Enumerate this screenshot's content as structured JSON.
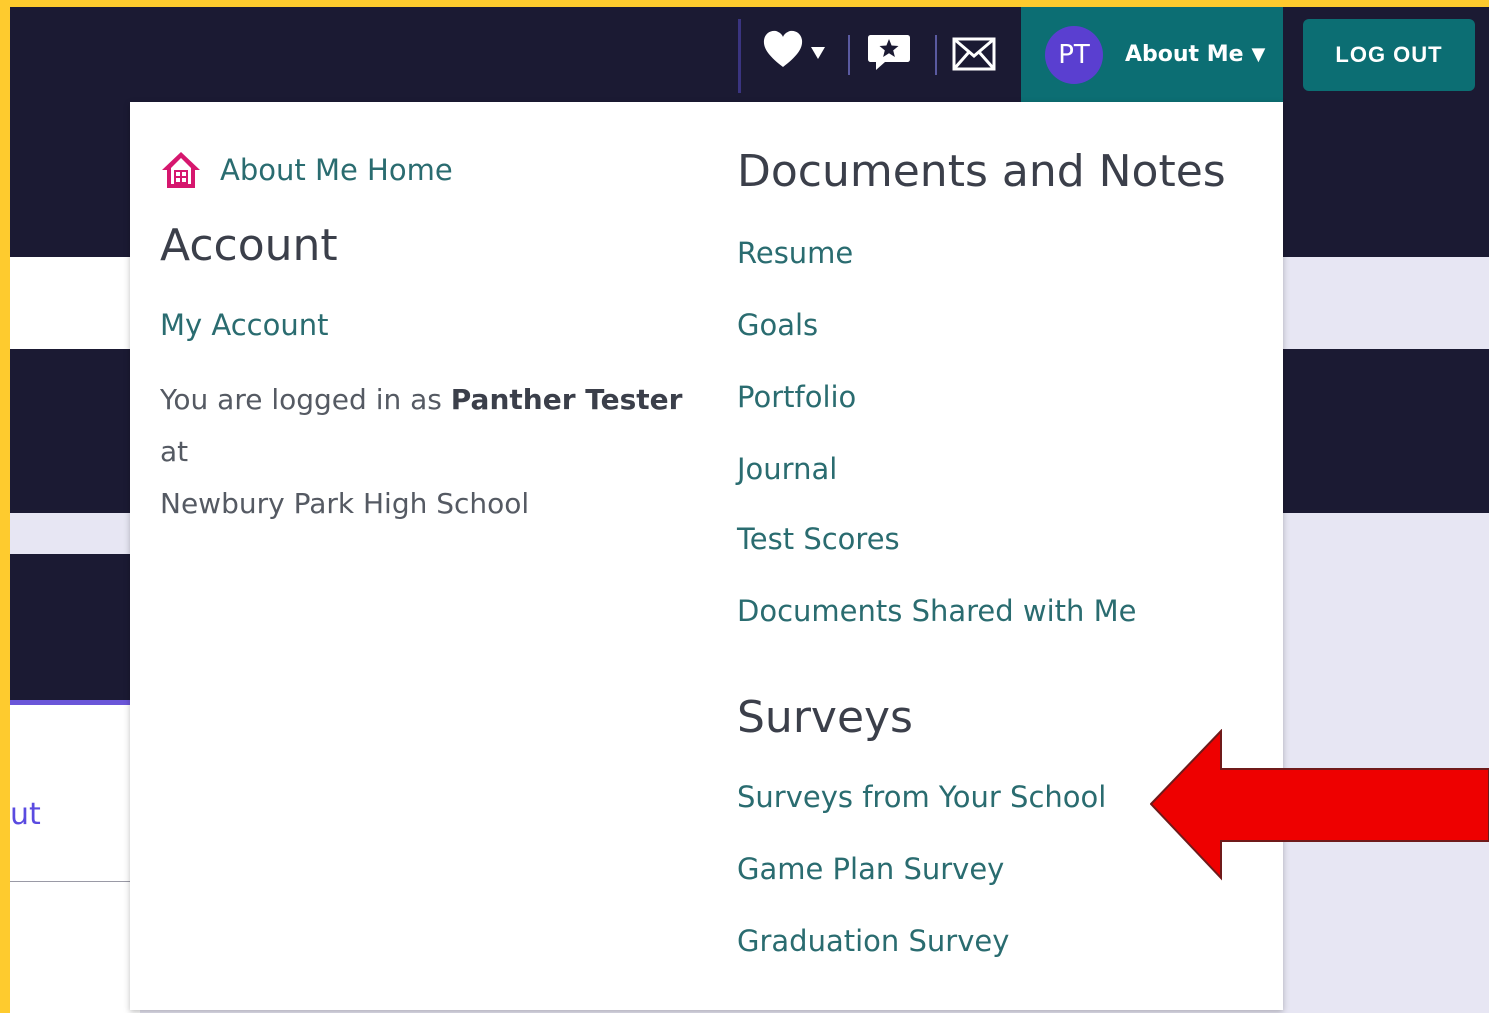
{
  "topbar": {
    "icons": [
      "heart-icon",
      "caret-down-icon",
      "chat-star-icon",
      "mail-icon"
    ],
    "avatar_initials": "PT",
    "about_me_label": "About Me",
    "about_me_caret": "▼",
    "logout_label": "LOG OUT"
  },
  "background": {
    "link_fragment": "ut"
  },
  "menu": {
    "home_label": "About Me Home",
    "account": {
      "heading": "Account",
      "my_account": "My Account",
      "logged_in_prefix": "You are logged in as",
      "user_name": "Panther Tester",
      "logged_in_mid": "at",
      "school": "Newbury Park High School"
    },
    "documents": {
      "heading": "Documents and Notes",
      "items": [
        "Resume",
        "Goals",
        "Portfolio",
        "Journal",
        "Test Scores",
        "Documents Shared with Me"
      ]
    },
    "surveys": {
      "heading": "Surveys",
      "items": [
        "Surveys from Your School",
        "Game Plan Survey",
        "Graduation Survey"
      ]
    }
  },
  "colors": {
    "frame": "#fecb2e",
    "navy": "#1b1a33",
    "teal": "#0c6e73",
    "link": "#2a6c70",
    "home_icon": "#d6176e",
    "arrow": "#ee0000"
  }
}
